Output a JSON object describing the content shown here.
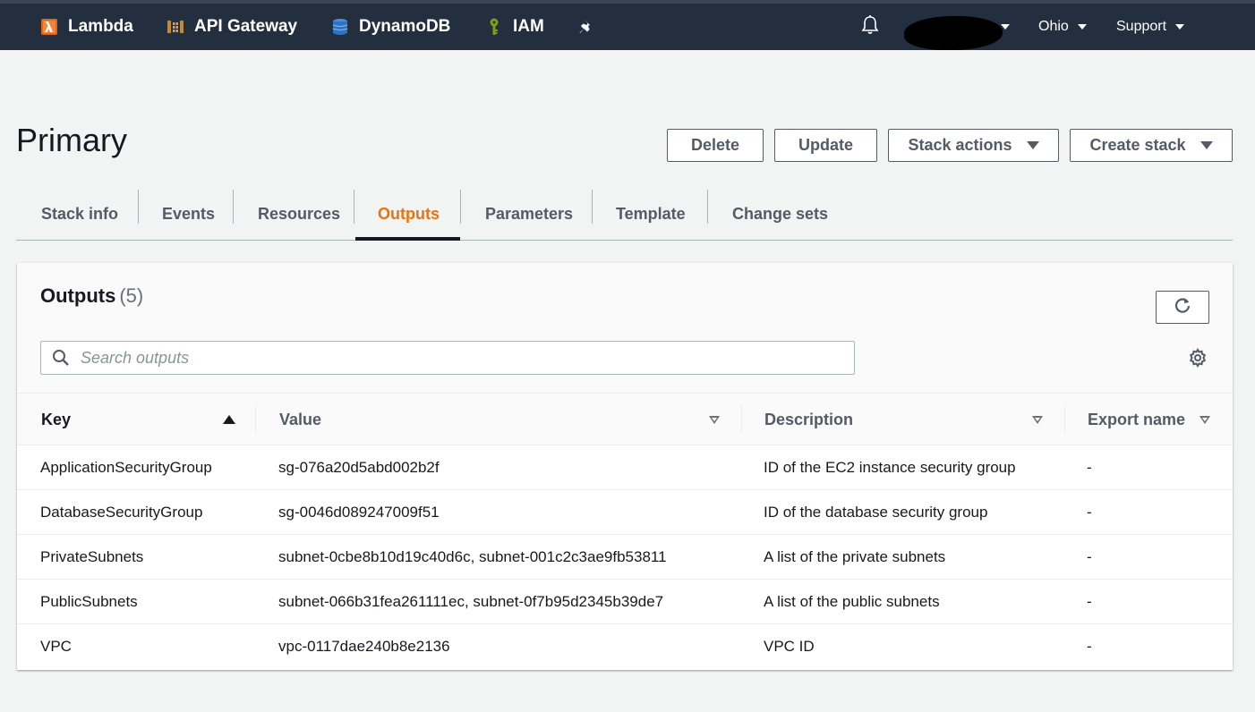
{
  "nav": {
    "items": [
      {
        "label": "Lambda",
        "icon": "lambda-icon"
      },
      {
        "label": "API Gateway",
        "icon": "api-gateway-icon"
      },
      {
        "label": "DynamoDB",
        "icon": "dynamodb-icon"
      },
      {
        "label": "IAM",
        "icon": "iam-icon"
      }
    ],
    "pin_icon": "pin-icon",
    "bell_icon": "bell-icon",
    "region": "Ohio",
    "support": "Support"
  },
  "header": {
    "title": "Primary",
    "buttons": {
      "delete": "Delete",
      "update": "Update",
      "stack_actions": "Stack actions",
      "create_stack": "Create stack"
    }
  },
  "tabs": [
    {
      "label": "Stack info",
      "active": false
    },
    {
      "label": "Events",
      "active": false
    },
    {
      "label": "Resources",
      "active": false
    },
    {
      "label": "Outputs",
      "active": true
    },
    {
      "label": "Parameters",
      "active": false
    },
    {
      "label": "Template",
      "active": false
    },
    {
      "label": "Change sets",
      "active": false
    }
  ],
  "outputs": {
    "title": "Outputs",
    "count": "(5)",
    "search_placeholder": "Search outputs",
    "columns": [
      "Key",
      "Value",
      "Description",
      "Export name"
    ],
    "rows": [
      {
        "key": "ApplicationSecurityGroup",
        "value": "sg-076a20d5abd002b2f",
        "description": "ID of the EC2 instance security group",
        "export": "-"
      },
      {
        "key": "DatabaseSecurityGroup",
        "value": "sg-0046d089247009f51",
        "description": "ID of the database security group",
        "export": "-"
      },
      {
        "key": "PrivateSubnets",
        "value": "subnet-0cbe8b10d19c40d6c, subnet-001c2c3ae9fb53811",
        "description": "A list of the private subnets",
        "export": "-"
      },
      {
        "key": "PublicSubnets",
        "value": "subnet-066b31fea261111ec, subnet-0f7b95d2345b39de7",
        "description": "A list of the public subnets",
        "export": "-"
      },
      {
        "key": "VPC",
        "value": "vpc-0117dae240b8e2136",
        "description": "VPC ID",
        "export": "-"
      }
    ]
  },
  "colors": {
    "nav_bg": "#232f3e",
    "accent": "#ec7211",
    "text": "#16191f",
    "muted": "#545b64"
  }
}
